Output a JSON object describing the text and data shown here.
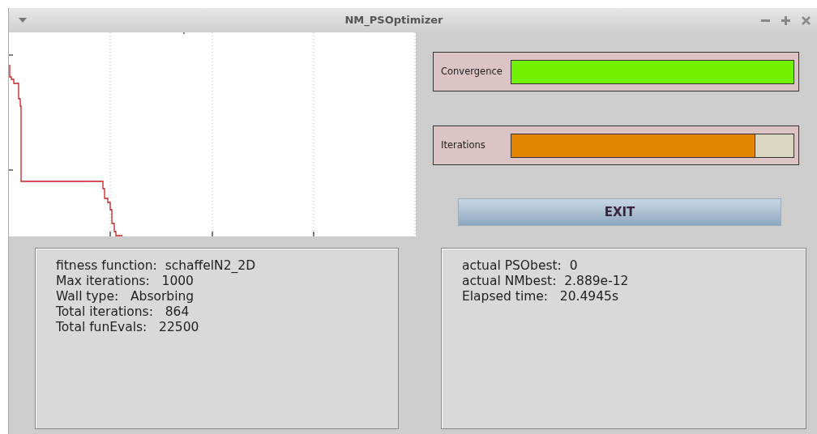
{
  "window": {
    "title": "NM_PSOptimizer"
  },
  "meters": [
    {
      "label": "Convergence",
      "level": 1.0,
      "color": "#72f200"
    },
    {
      "label": "Iterations",
      "level": 0.864,
      "color": "#e08600"
    }
  ],
  "exit_button": {
    "label": "EXIT"
  },
  "run_settings": [
    "fitness function:  schaffelN2_2D",
    "Max iterations:   1000",
    "Wall type:   Absorbing",
    "Total iterations:   864",
    "Total funEvals:   22500"
  ],
  "results": [
    "actual PSObest:  0",
    "actual NMbest:  2.889e-12",
    "Elapsed time:   20.4945s"
  ]
}
